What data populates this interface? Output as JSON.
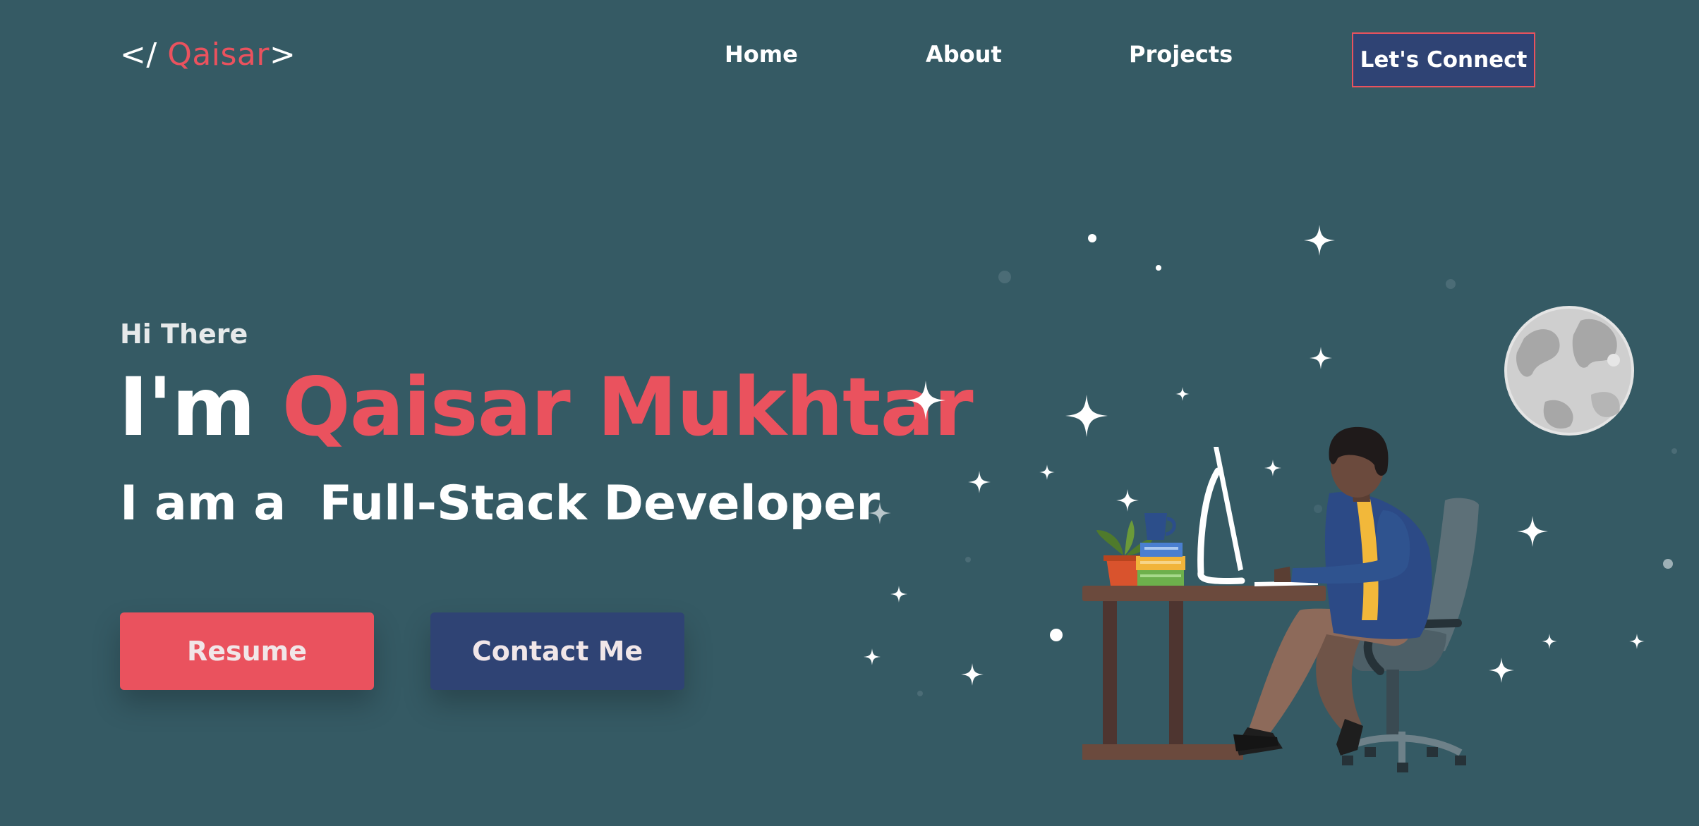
{
  "header": {
    "logo": {
      "prefix": "</ ",
      "name": "Qaisar",
      "suffix": ">"
    },
    "nav": {
      "home": "Home",
      "about": "About",
      "projects": "Projects"
    },
    "cta_label": "Let's Connect"
  },
  "hero": {
    "greeting": "Hi There",
    "headline_prefix": "I'm ",
    "headline_name": "Qaisar Mukhtar",
    "subline": "I am a  Full-Stack Developer",
    "buttons": {
      "resume": "Resume",
      "contact": "Contact Me"
    }
  },
  "colors": {
    "background": "#355a64",
    "accent": "#ea525e",
    "navy": "#2f4374",
    "text": "#ffffff"
  },
  "illustration": {
    "icons": [
      "sparkle-star-icon",
      "moon-icon",
      "developer-at-desk-illustration",
      "monitor-icon",
      "plant-icon",
      "mug-icon",
      "books-icon",
      "office-chair-icon"
    ]
  }
}
